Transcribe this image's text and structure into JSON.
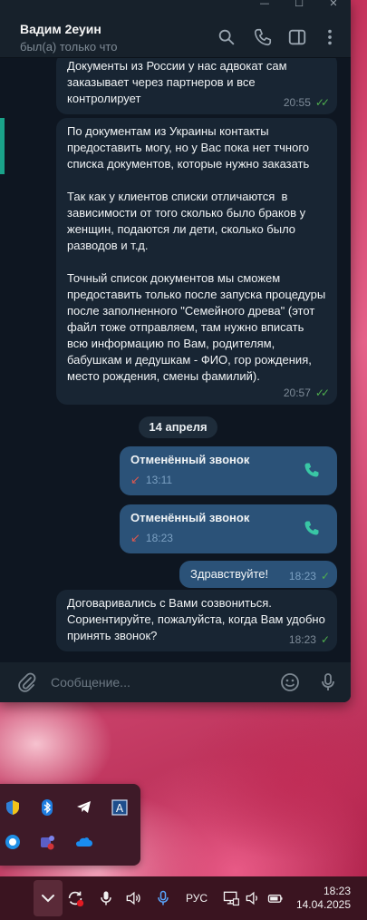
{
  "window": {
    "controls": [
      "—",
      "☐",
      "✕"
    ],
    "header": {
      "name": "Вадим 2еуин",
      "status": "был(а) только что"
    },
    "icons": [
      "search-icon",
      "phone-icon",
      "sidebar-toggle-icon",
      "more-vertical-icon"
    ]
  },
  "messages": [
    {
      "type": "incoming",
      "text": "Документы из России у нас адвокат сам заказывает через партнеров и все контролирует",
      "time": "20:55",
      "status": "read"
    },
    {
      "type": "incoming",
      "text": "По документам из Украины контакты предоставить могу, но у Вас пока нет тчного списка документов, которые нужно заказать\n\nТак как у клиентов списки отличаются  в зависимости от того сколько было браков у женщин, подаются ли дети, сколько было разводов и т.д.\n\nТочный список документов мы сможем предоставить только после запуска процедуры после заполненного \"Семейного древа\" (этот файл тоже отправляем, там нужно вписать всю информацию по Вам, родителям, бабушкам и дедушкам - ФИО, гор рождения, место рождения, смены фамилий).",
      "time": "20:57",
      "status": "read"
    }
  ],
  "date_separator": "14 апреля",
  "calls": [
    {
      "title": "Отменённый звонок",
      "time": "13:11"
    },
    {
      "title": "Отменённый звонок",
      "time": "18:23"
    }
  ],
  "out_message": {
    "text": "Здравствуйте!",
    "time": "18:23"
  },
  "last_message": {
    "text": "Договаривались с Вами созвониться. Сориентируйте, пожалуйста, когда Вам удобно принять звонок?",
    "time": "18:23"
  },
  "composer": {
    "placeholder": "Сообщение..."
  },
  "tray": {
    "icons": [
      "defender-icon",
      "bluetooth-icon",
      "telegram-icon",
      "language-bar-icon",
      "skype-icon",
      "teams-icon",
      "onedrive-icon"
    ]
  },
  "taskbar": {
    "lang": "РУС",
    "time": "18:23",
    "date": "14.04.2025"
  },
  "colors": {
    "accent": "#1aa38a",
    "bubble_in": "#182533",
    "bubble_out": "#2b5278",
    "check": "#4fae4e",
    "missed": "#e0584f"
  }
}
